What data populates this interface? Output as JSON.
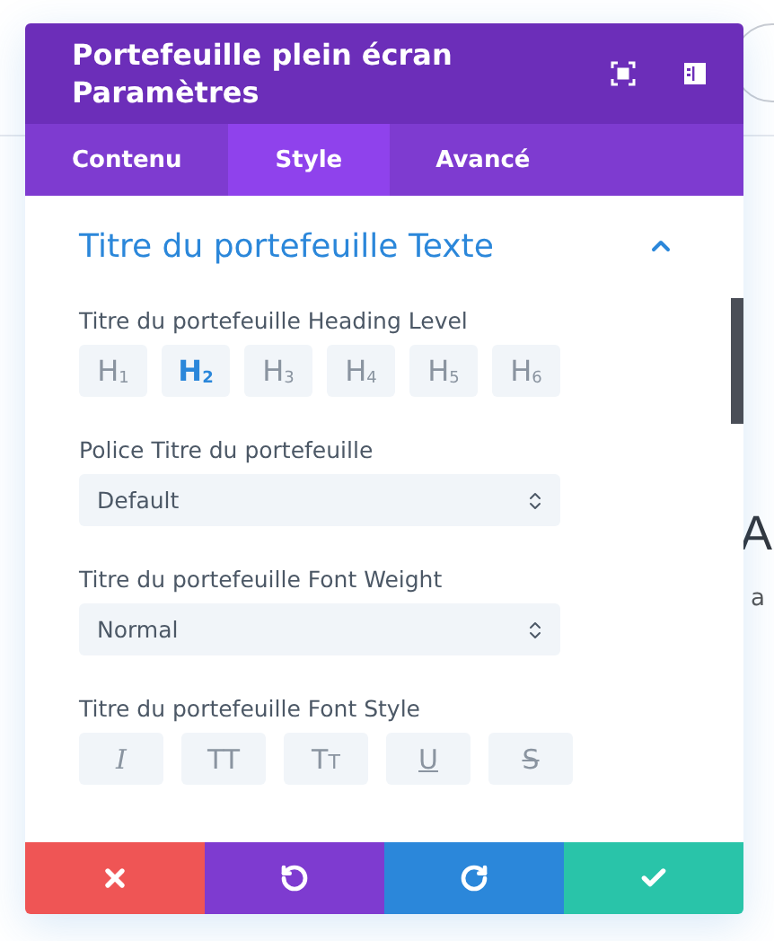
{
  "background": {
    "heading": "A",
    "text": "a"
  },
  "modal": {
    "title": "Portefeuille plein écran Paramètres",
    "tabs": [
      {
        "label": "Contenu",
        "selected": false
      },
      {
        "label": "Style",
        "selected": true
      },
      {
        "label": "Avancé",
        "selected": false
      }
    ],
    "section": {
      "title": "Titre du portefeuille Texte",
      "expanded": true
    },
    "heading_level": {
      "label": "Titre du portefeuille Heading Level",
      "options": [
        {
          "label": "H$_{1}$",
          "selected": false
        },
        {
          "label": "H$_{2}$",
          "selected": true
        },
        {
          "label": "H$_{3}$",
          "selected": false
        },
        {
          "label": "H$_{4}$",
          "selected": false
        },
        {
          "label": "H$_{5}$",
          "selected": false
        },
        {
          "label": "H$_{6}$",
          "selected": false
        }
      ]
    },
    "font": {
      "label": "Police Titre du portefeuille",
      "value": "Default"
    },
    "font_weight": {
      "label": "Titre du portefeuille Font Weight",
      "value": "Normal"
    },
    "font_style": {
      "label": "Titre du portefeuille Font Style",
      "options": [
        {
          "kind": "italic",
          "label": "I",
          "selected": false
        },
        {
          "kind": "uppercase",
          "label": "TT",
          "selected": false
        },
        {
          "kind": "smallcaps",
          "label": "Tt",
          "selected": false
        },
        {
          "kind": "underline",
          "label": "U",
          "selected": false
        },
        {
          "kind": "strikethrough",
          "label": "S",
          "selected": false
        }
      ]
    }
  }
}
